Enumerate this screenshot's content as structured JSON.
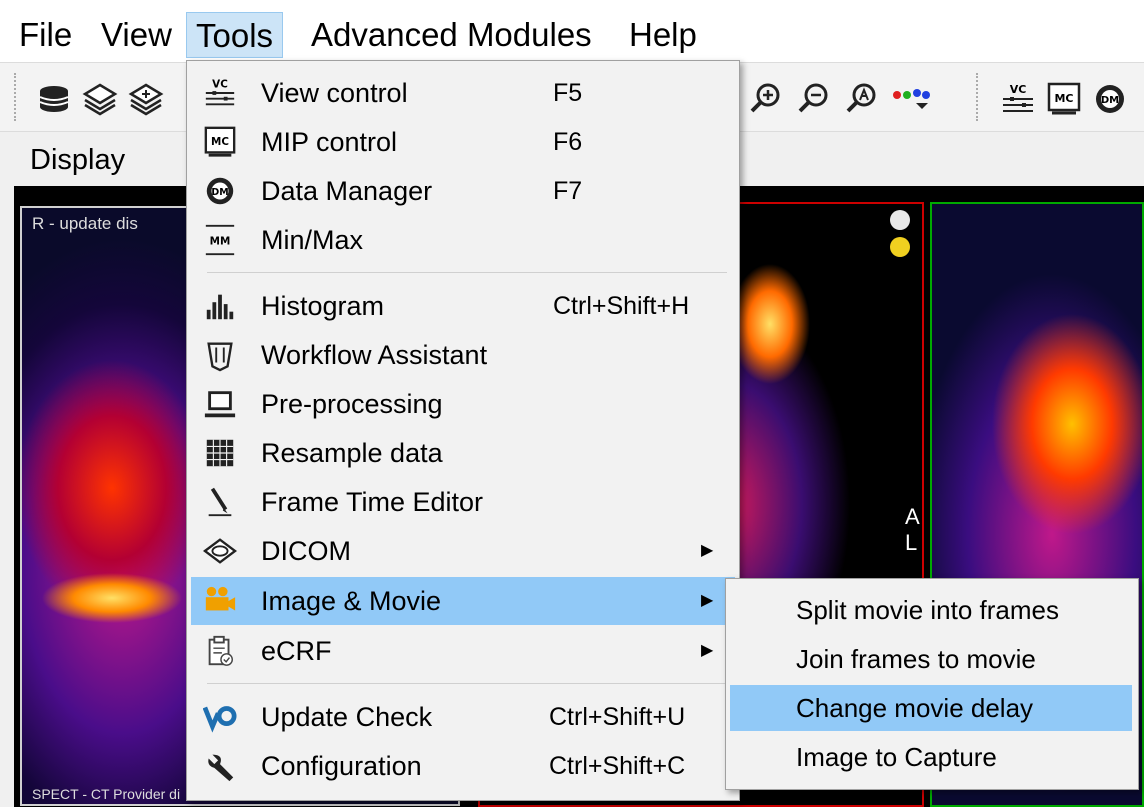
{
  "menubar": {
    "items": [
      {
        "label": "File"
      },
      {
        "label": "View"
      },
      {
        "label": "Tools"
      },
      {
        "label": "Advanced Modules"
      },
      {
        "label": "Help"
      }
    ],
    "active": "Tools"
  },
  "toolbar": {
    "icons": [
      "database-icon",
      "layers-1-icon",
      "layers-add-icon",
      "zoom-in-icon",
      "zoom-out-icon",
      "zoom-auto-icon",
      "color-dots-dropdown-icon",
      "view-control-icon",
      "mip-control-icon",
      "data-manager-icon"
    ]
  },
  "display": {
    "label": "Display",
    "pane1_overlay": "R - update dis",
    "pane1_bottom": "SPECT - CT Provider di",
    "orientation": "A L",
    "dots": [
      "#e8e8e8",
      "#f0d020"
    ]
  },
  "tools_menu": {
    "items": [
      {
        "label": "View control",
        "shortcut": "F5",
        "icon": "view-control-icon"
      },
      {
        "label": "MIP control",
        "shortcut": "F6",
        "icon": "mip-control-icon"
      },
      {
        "label": "Data Manager",
        "shortcut": "F7",
        "icon": "data-manager-icon"
      },
      {
        "label": "Min/Max",
        "shortcut": "",
        "icon": "min-max-icon"
      },
      {
        "label": "Histogram",
        "shortcut": "Ctrl+Shift+H",
        "icon": "histogram-icon"
      },
      {
        "label": "Workflow Assistant",
        "shortcut": "",
        "icon": "workflow-icon"
      },
      {
        "label": "Pre-processing",
        "shortcut": "",
        "icon": "laptop-icon"
      },
      {
        "label": "Resample data",
        "shortcut": "",
        "icon": "grid-icon"
      },
      {
        "label": "Frame Time Editor",
        "shortcut": "",
        "icon": "pen-icon"
      },
      {
        "label": "DICOM",
        "shortcut": "",
        "icon": "dicom-icon"
      },
      {
        "label": "Image & Movie",
        "shortcut": "",
        "icon": "camera-icon"
      },
      {
        "label": "eCRF",
        "shortcut": "",
        "icon": "clipboard-icon"
      },
      {
        "label": "Update Check",
        "shortcut": "Ctrl+Shift+U",
        "icon": "update-icon"
      },
      {
        "label": "Configuration",
        "shortcut": "Ctrl+Shift+C",
        "icon": "wrench-icon"
      }
    ]
  },
  "image_movie_submenu": {
    "items": [
      {
        "label": "Split movie into frames"
      },
      {
        "label": "Join frames to movie"
      },
      {
        "label": "Change movie delay"
      },
      {
        "label": "Image to Capture"
      }
    ],
    "highlighted": "Change movie delay"
  },
  "colors": {
    "highlight": "#91c9f7",
    "menu_bg": "#f2f2f2",
    "active_menu_bg": "#cce4f7"
  }
}
